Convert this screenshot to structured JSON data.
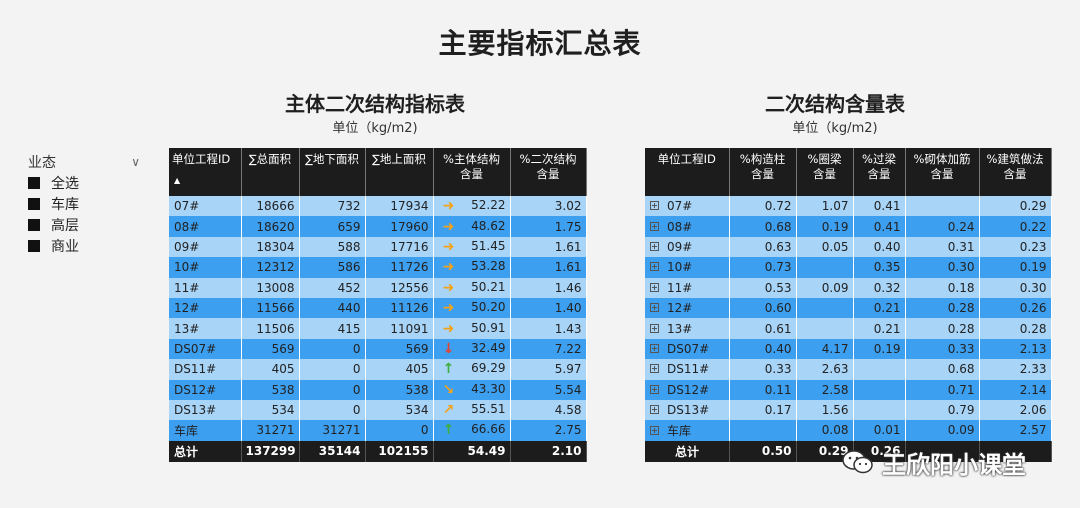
{
  "page_title": "主要指标汇总表",
  "slicer": {
    "title": "业态",
    "items": [
      "全选",
      "车库",
      "高层",
      "商业"
    ]
  },
  "table1": {
    "title": "主体二次结构指标表",
    "unit": "单位（kg/m2)",
    "headers": [
      "单位工程ID",
      "∑总面积",
      "∑地下面积",
      "∑地上面积",
      "%主体结构\n含量",
      "%二次结构\n含量"
    ],
    "rows": [
      {
        "id": "07#",
        "total": "18666",
        "under": "732",
        "above": "17934",
        "arrow": "right",
        "main": "52.22",
        "sec": "3.02"
      },
      {
        "id": "08#",
        "total": "18620",
        "under": "659",
        "above": "17960",
        "arrow": "right",
        "main": "48.62",
        "sec": "1.75"
      },
      {
        "id": "09#",
        "total": "18304",
        "under": "588",
        "above": "17716",
        "arrow": "right",
        "main": "51.45",
        "sec": "1.61"
      },
      {
        "id": "10#",
        "total": "12312",
        "under": "586",
        "above": "11726",
        "arrow": "right",
        "main": "53.28",
        "sec": "1.61"
      },
      {
        "id": "11#",
        "total": "13008",
        "under": "452",
        "above": "12556",
        "arrow": "right",
        "main": "50.21",
        "sec": "1.46"
      },
      {
        "id": "12#",
        "total": "11566",
        "under": "440",
        "above": "11126",
        "arrow": "right",
        "main": "50.20",
        "sec": "1.40"
      },
      {
        "id": "13#",
        "total": "11506",
        "under": "415",
        "above": "11091",
        "arrow": "right",
        "main": "50.91",
        "sec": "1.43"
      },
      {
        "id": "DS07#",
        "total": "569",
        "under": "0",
        "above": "569",
        "arrow": "down",
        "main": "32.49",
        "sec": "7.22"
      },
      {
        "id": "DS11#",
        "total": "405",
        "under": "0",
        "above": "405",
        "arrow": "up",
        "main": "69.29",
        "sec": "5.97"
      },
      {
        "id": "DS12#",
        "total": "538",
        "under": "0",
        "above": "538",
        "arrow": "down-right",
        "main": "43.30",
        "sec": "5.54"
      },
      {
        "id": "DS13#",
        "total": "534",
        "under": "0",
        "above": "534",
        "arrow": "up-right",
        "main": "55.51",
        "sec": "4.58"
      },
      {
        "id": "车库",
        "total": "31271",
        "under": "31271",
        "above": "0",
        "arrow": "up",
        "main": "66.66",
        "sec": "2.75"
      }
    ],
    "total": {
      "id": "总计",
      "total": "137299",
      "under": "35144",
      "above": "102155",
      "main": "54.49",
      "sec": "2.10"
    }
  },
  "table2": {
    "title": "二次结构含量表",
    "unit": "单位（kg/m2)",
    "headers": [
      "单位工程ID",
      "%构造柱\n含量",
      "%圈梁\n含量",
      "%过梁\n含量",
      "%砌体加筋\n含量",
      "%建筑做法\n含量"
    ],
    "rows": [
      {
        "id": "07#",
        "c1": "0.72",
        "c2": "1.07",
        "c3": "0.41",
        "c4": "",
        "c5": "0.29"
      },
      {
        "id": "08#",
        "c1": "0.68",
        "c2": "0.19",
        "c3": "0.41",
        "c4": "0.24",
        "c5": "0.22"
      },
      {
        "id": "09#",
        "c1": "0.63",
        "c2": "0.05",
        "c3": "0.40",
        "c4": "0.31",
        "c5": "0.23"
      },
      {
        "id": "10#",
        "c1": "0.73",
        "c2": "",
        "c3": "0.35",
        "c4": "0.30",
        "c5": "0.19"
      },
      {
        "id": "11#",
        "c1": "0.53",
        "c2": "0.09",
        "c3": "0.32",
        "c4": "0.18",
        "c5": "0.30"
      },
      {
        "id": "12#",
        "c1": "0.60",
        "c2": "",
        "c3": "0.21",
        "c4": "0.28",
        "c5": "0.26"
      },
      {
        "id": "13#",
        "c1": "0.61",
        "c2": "",
        "c3": "0.21",
        "c4": "0.28",
        "c5": "0.28"
      },
      {
        "id": "DS07#",
        "c1": "0.40",
        "c2": "4.17",
        "c3": "0.19",
        "c4": "0.33",
        "c5": "2.13"
      },
      {
        "id": "DS11#",
        "c1": "0.33",
        "c2": "2.63",
        "c3": "",
        "c4": "0.68",
        "c5": "2.33"
      },
      {
        "id": "DS12#",
        "c1": "0.11",
        "c2": "2.58",
        "c3": "",
        "c4": "0.71",
        "c5": "2.14"
      },
      {
        "id": "DS13#",
        "c1": "0.17",
        "c2": "1.56",
        "c3": "",
        "c4": "0.79",
        "c5": "2.06"
      },
      {
        "id": "车库",
        "c1": "",
        "c2": "0.08",
        "c3": "0.01",
        "c4": "0.09",
        "c5": "2.57"
      }
    ],
    "total": {
      "id": "总计",
      "c1": "0.50",
      "c2": "0.29",
      "c3": "0.26",
      "c4": "",
      "c5": ""
    }
  },
  "watermark": "王欣阳小课堂",
  "colors": {
    "row_light": "#a8d4f7",
    "row_dark": "#3d9ff0",
    "header": "#1c1c1c",
    "arrow_right": "#f2a21b",
    "arrow_down": "#e8412b",
    "arrow_up": "#3fae3f"
  }
}
